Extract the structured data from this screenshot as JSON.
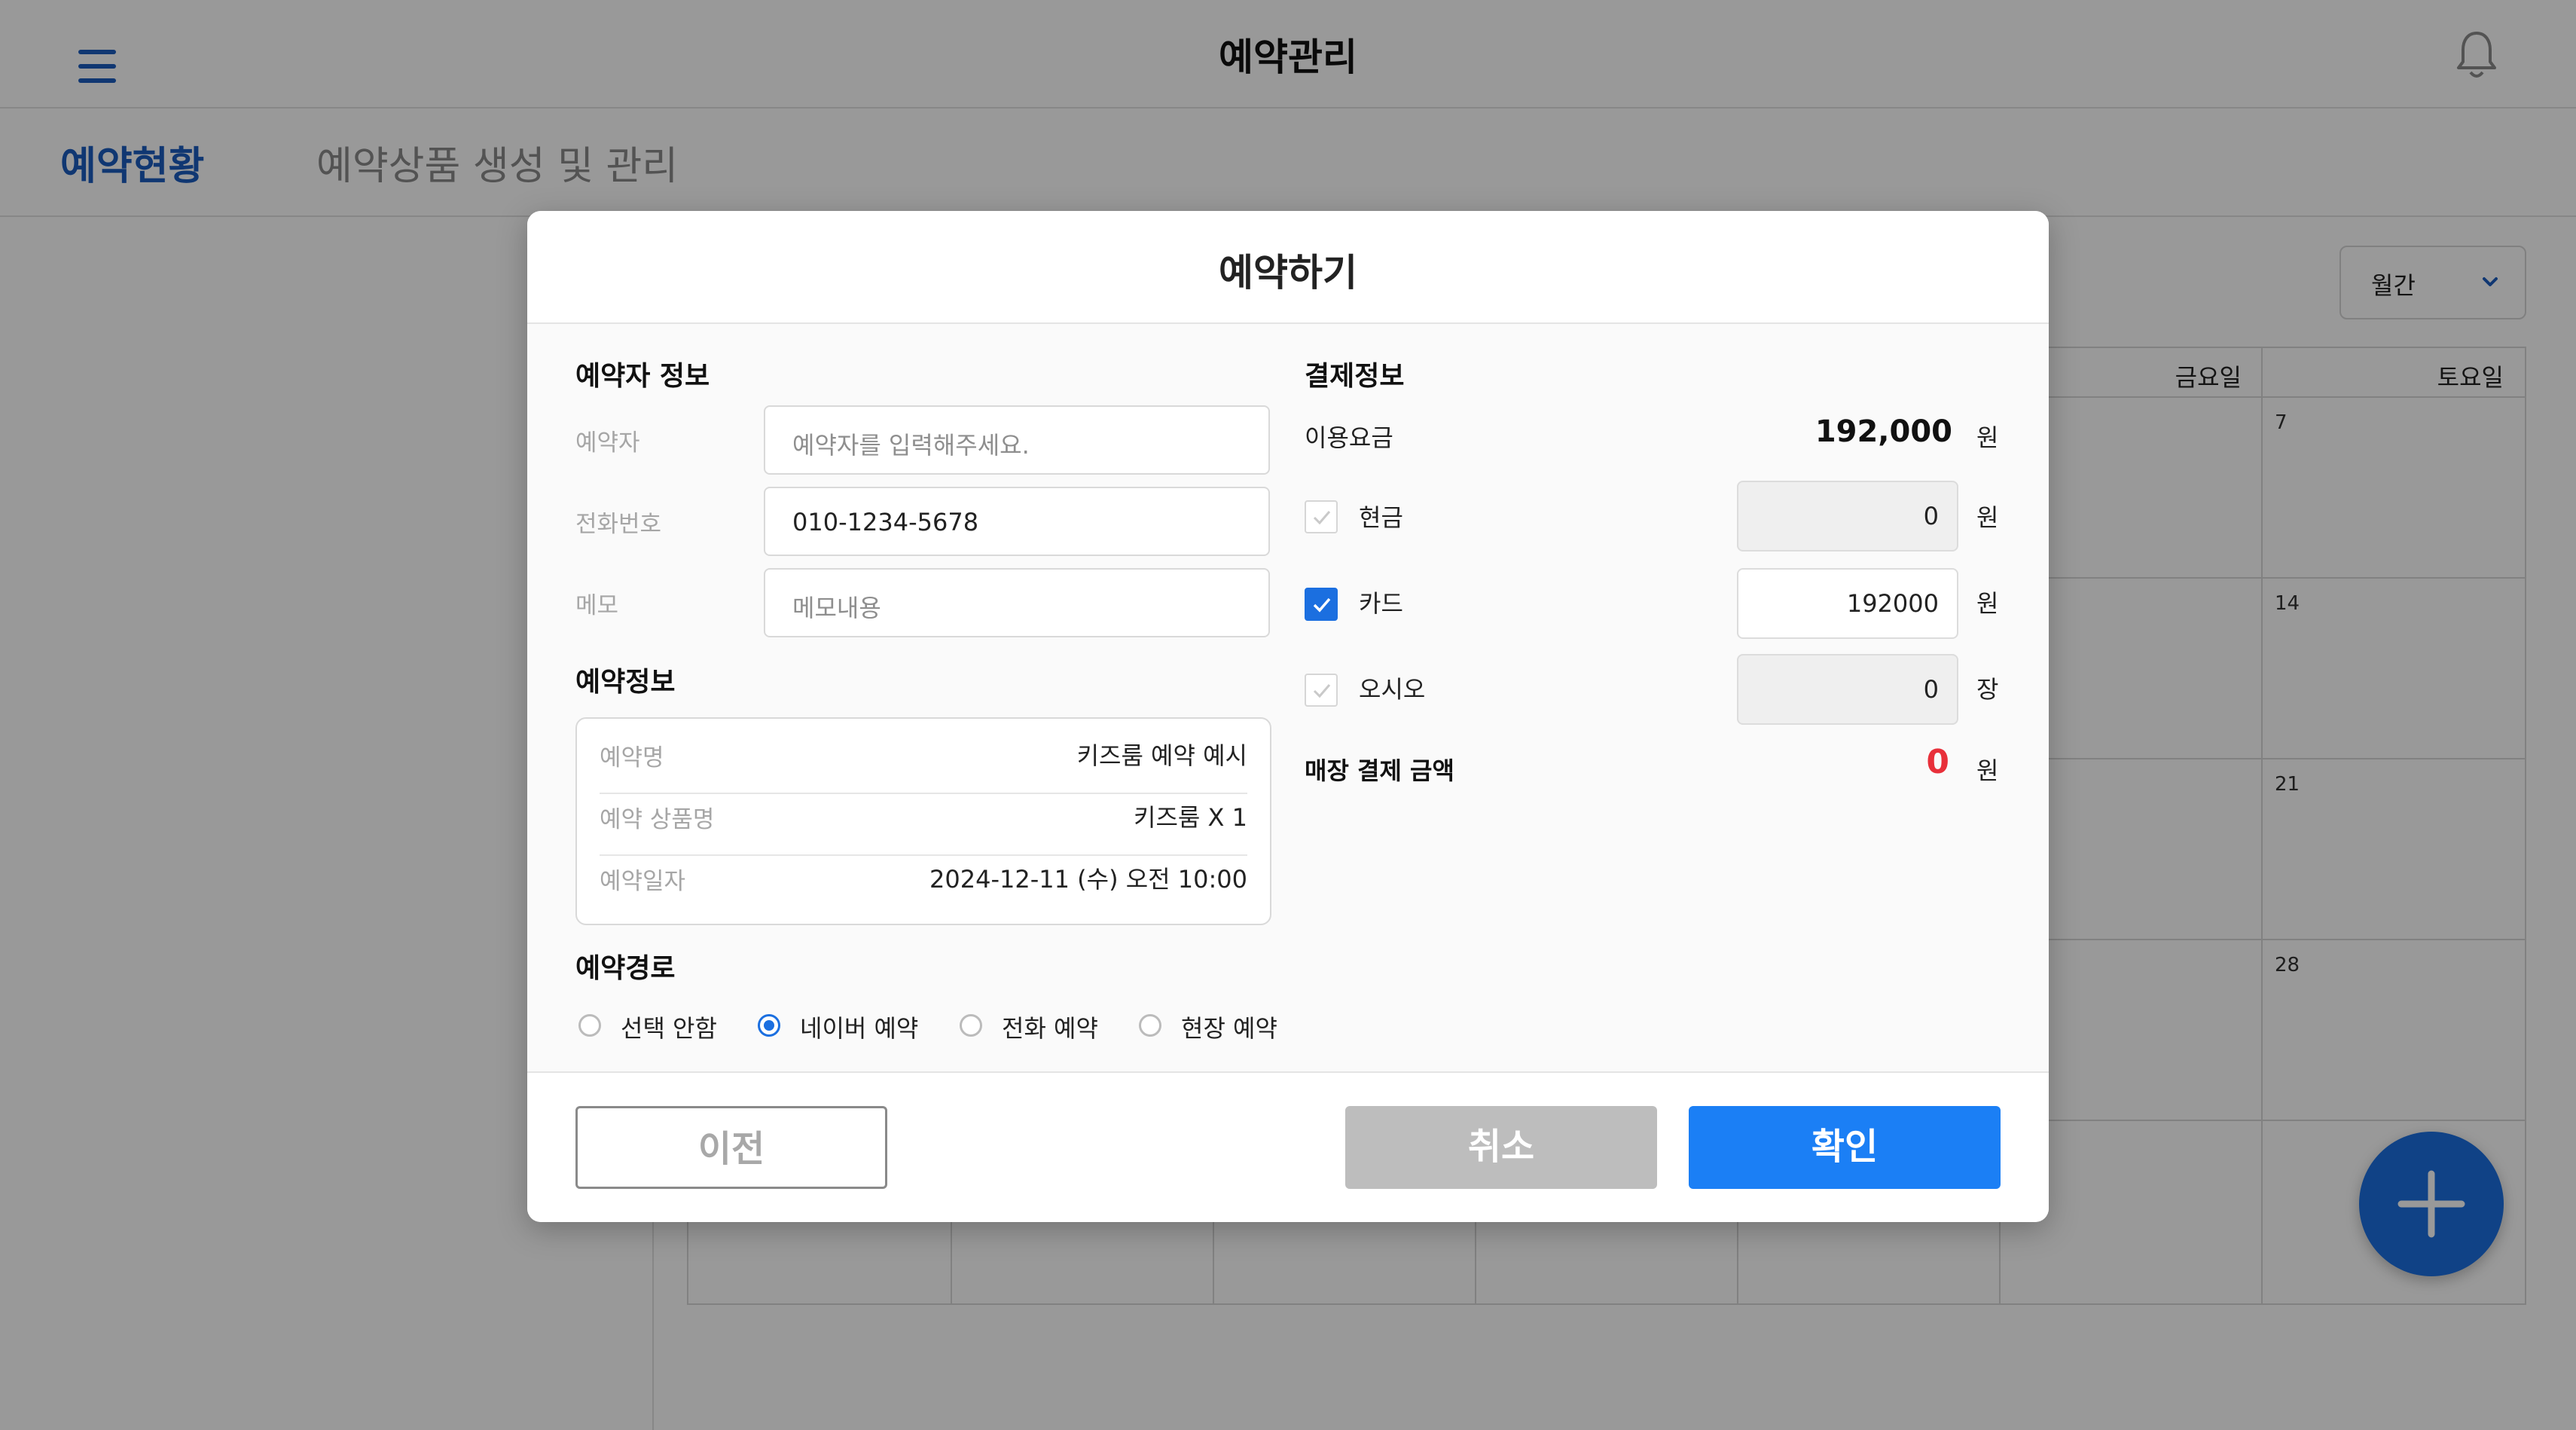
{
  "app": {
    "title": "예약관리",
    "tabs": [
      "예약현황",
      "예약상품 생성 및 관리"
    ],
    "view_select": "월간",
    "calendar": {
      "day_headers": [
        "금요일",
        "토요일"
      ],
      "saturday_dates": [
        "7",
        "14",
        "21",
        "28"
      ]
    },
    "accent_color": "#1b6fe0"
  },
  "modal": {
    "title": "예약하기",
    "booker": {
      "section_title": "예약자 정보",
      "name_label": "예약자",
      "name_placeholder": "예약자를 입력해주세요.",
      "phone_label": "전화번호",
      "phone_value": "010-1234-5678",
      "memo_label": "메모",
      "memo_placeholder": "메모내용"
    },
    "reservation": {
      "section_title": "예약정보",
      "rows": [
        {
          "label": "예약명",
          "value": "키즈룸 예약 예시"
        },
        {
          "label": "예약 상품명",
          "value": "키즈룸 X 1"
        },
        {
          "label": "예약일자",
          "value": "2024-12-11 (수) 오전 10:00"
        }
      ]
    },
    "route": {
      "section_title": "예약경로",
      "options": [
        "선택 안함",
        "네이버 예약",
        "전화 예약",
        "현장 예약"
      ],
      "selected": "네이버 예약"
    },
    "payment": {
      "section_title": "결제정보",
      "fee_label": "이용요금",
      "fee_amount": "192,000",
      "fee_unit": "원",
      "cash_label": "현금",
      "cash_value": "0",
      "cash_unit": "원",
      "cash_checked": false,
      "card_label": "카드",
      "card_value": "192000",
      "card_unit": "원",
      "card_checked": true,
      "osio_label": "오시오",
      "osio_value": "0",
      "osio_unit": "장",
      "osio_checked": false,
      "store_label": "매장 결제 금액",
      "store_amount": "0",
      "store_unit": "원",
      "store_amount_color": "#e8303a"
    },
    "buttons": {
      "prev": "이전",
      "cancel": "취소",
      "confirm": "확인"
    }
  }
}
